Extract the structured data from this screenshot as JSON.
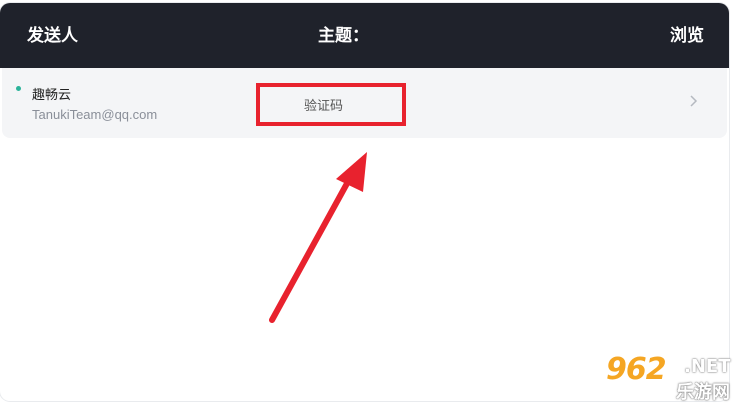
{
  "header": {
    "sender_col": "发送人",
    "subject_col": "主题：",
    "view_col": "浏览"
  },
  "messages": [
    {
      "sender_name": "趣畅云",
      "sender_email": "TanukiTeam@qq.com",
      "subject": "验证码",
      "unread": true
    }
  ],
  "annotation": {
    "highlight_color": "#e8222e"
  },
  "watermark": {
    "number": "962",
    "suffix": ".NET",
    "site": "乐游网"
  },
  "colors": {
    "header_bg": "#1f222b",
    "row_bg": "#f4f5f7",
    "unread_dot": "#2bb39a",
    "watermark_orange": "#f5a623"
  },
  "icons": {
    "row_action": "chevron-right-icon",
    "unread": "unread-dot-icon"
  }
}
